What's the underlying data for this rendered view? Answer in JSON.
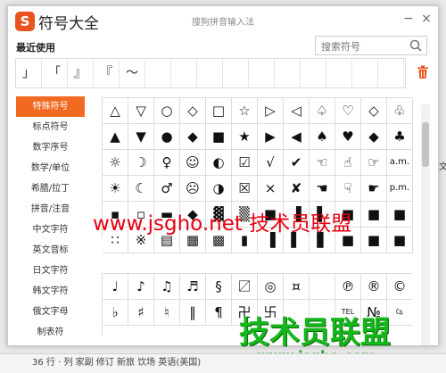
{
  "window": {
    "logo": "S",
    "title": "符号大全",
    "subtitle": "搜狗拼音输入法",
    "min_glyph": "−",
    "close_glyph": "×"
  },
  "recent": {
    "label": "最近使用",
    "items": [
      "」",
      "「",
      "』",
      "『",
      "～",
      "",
      "",
      "",
      "",
      "",
      "",
      "",
      "",
      "",
      ""
    ]
  },
  "search": {
    "placeholder": "搜索符号"
  },
  "sidebar": {
    "items": [
      {
        "label": "特殊符号",
        "active": true
      },
      {
        "label": "标点符号",
        "active": false
      },
      {
        "label": "数字序号",
        "active": false
      },
      {
        "label": "数学/单位",
        "active": false
      },
      {
        "label": "希腊/拉丁",
        "active": false
      },
      {
        "label": "拼音/注音",
        "active": false
      },
      {
        "label": "中文字符",
        "active": false
      },
      {
        "label": "英文音标",
        "active": false
      },
      {
        "label": "日文字符",
        "active": false
      },
      {
        "label": "韩文字符",
        "active": false
      },
      {
        "label": "俄文字母",
        "active": false
      },
      {
        "label": "制表符",
        "active": false
      }
    ]
  },
  "grid1": [
    "△",
    "▽",
    "○",
    "◇",
    "□",
    "☆",
    "▷",
    "◁",
    "♤",
    "♡",
    "◇",
    "♧",
    "▲",
    "▼",
    "●",
    "◆",
    "■",
    "★",
    "▶",
    "◀",
    "♠",
    "♥",
    "◆",
    "♣",
    "☼",
    "☽",
    "♀",
    "☺",
    "◐",
    "☑",
    "√",
    "✔",
    "☜",
    "☝",
    "☞",
    "a.m.",
    "☀",
    "☾",
    "♂",
    "☹",
    "◑",
    "☒",
    "×",
    "✘",
    "☚",
    "☟",
    "☛",
    "p.m.",
    "▪",
    "▫",
    "▬",
    "◆",
    "▓",
    "▒",
    "■",
    "▐",
    "▌",
    "■",
    "■",
    "■",
    "∷",
    "※",
    "▤",
    "▦",
    "▩",
    "▮",
    "▐",
    "▌",
    "▋",
    "■",
    "■",
    "■"
  ],
  "grid2": [
    "♩",
    "♪",
    "♫",
    "♬",
    "§",
    "〼",
    "◎",
    "¤",
    "",
    "℗",
    "®",
    "©",
    "♭",
    "♯",
    "♮",
    "‖",
    "¶",
    "卍",
    "卐",
    "",
    "",
    "TEL",
    "№",
    "㏇"
  ],
  "watermarks": {
    "red": "www.jsgho.net 技术员联盟",
    "green_big": "技术员联盟",
    "green_small": "www.jsgho.com"
  },
  "bottom_bar": "36 行    ·    列   家副   修订   新旅   饮场   英语(美国)",
  "behind_text": "文,"
}
